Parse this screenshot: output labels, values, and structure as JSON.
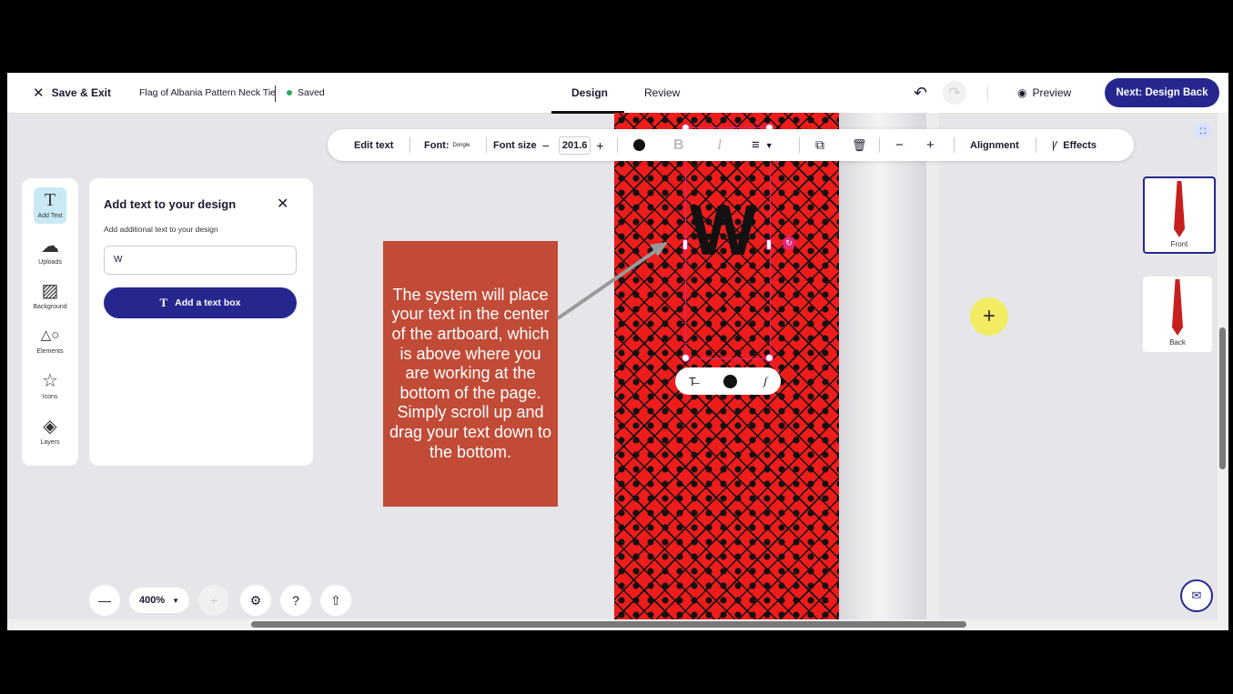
{
  "header": {
    "save_exit_label": "Save & Exit",
    "doc_title": "Flag of Albania Pattern Neck Tie",
    "saved_label": "Saved",
    "tabs": [
      {
        "label": "Design"
      },
      {
        "label": "Review"
      }
    ],
    "preview_label": "Preview",
    "next_label": "Next: Design Back"
  },
  "toolbar": {
    "edit_text": "Edit text",
    "font_label": "Font:",
    "font_value": "Dongle",
    "font_size_label": "Font size",
    "font_size_value": "201.6",
    "bold_label": "B",
    "italic_label": "I",
    "alignment_label": "Alignment",
    "effects_label": "Effects"
  },
  "rail": {
    "items": [
      {
        "label": "Add Text"
      },
      {
        "label": "Uploads"
      },
      {
        "label": "Background"
      },
      {
        "label": "Elements"
      },
      {
        "label": "Icons"
      },
      {
        "label": "Layers"
      }
    ]
  },
  "panel": {
    "title": "Add text to your design",
    "subtitle": "Add additional text to your design",
    "input_value": "W",
    "button_label": "Add a text box"
  },
  "canvas": {
    "text_value": "W",
    "callout": "The system will place your text in the center of the artboard, which is above where you are working at the bottom of the page. Simply scroll up and drag your text down to the bottom."
  },
  "thumbs": [
    {
      "label": "Front"
    },
    {
      "label": "Back"
    }
  ],
  "zoom": {
    "value": "400%"
  },
  "colors": {
    "accent": "#25278f",
    "tie": "#ef1c1c",
    "selection": "#e0287a",
    "callout": "#c14b37"
  }
}
